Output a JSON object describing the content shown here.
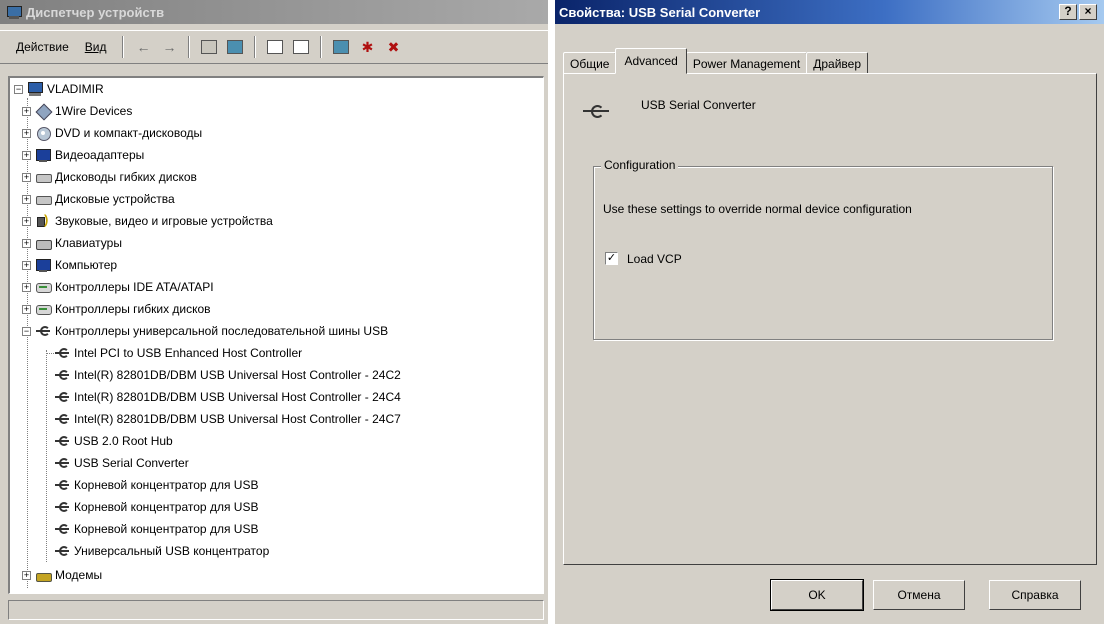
{
  "device_manager": {
    "title": "Диспетчер устройств",
    "menu": {
      "action": "Действие",
      "view": "Вид"
    },
    "toolbar_icons": [
      "back-arrow-icon",
      "forward-arrow-icon",
      "up-folder-icon",
      "properties-list-icon",
      "properties-icon",
      "help-icon",
      "scan-hardware-icon",
      "update-driver-icon",
      "uninstall-icon"
    ],
    "tree": {
      "root": "VLADIMIR",
      "categories": [
        "1Wire Devices",
        "DVD и компакт-дисководы",
        "Видеоадаптеры",
        "Дисководы гибких дисков",
        "Дисковые устройства",
        "Звуковые, видео и игровые устройства",
        "Клавиатуры",
        "Компьютер",
        "Контроллеры IDE ATA/ATAPI",
        "Контроллеры гибких дисков",
        "Контроллеры универсальной последовательной шины USB"
      ],
      "usb_children": [
        "Intel PCI to USB Enhanced Host Controller",
        "Intel(R) 82801DB/DBM USB Universal Host Controller - 24C2",
        "Intel(R) 82801DB/DBM USB Universal Host Controller - 24C4",
        "Intel(R) 82801DB/DBM USB Universal Host Controller - 24C7",
        "USB 2.0 Root Hub",
        "USB Serial Converter",
        "Корневой концентратор для USB",
        "Корневой концентратор для USB",
        "Корневой концентратор для USB",
        "Универсальный USB концентратор"
      ],
      "last": "Модемы"
    }
  },
  "properties": {
    "title": "Свойства: USB Serial Converter",
    "help_btn": "?",
    "close_btn": "×",
    "tabs": [
      "Общие",
      "Advanced",
      "Power Management",
      "Драйвер"
    ],
    "active_tab": "Advanced",
    "device_name": "USB Serial Converter",
    "group_label": "Configuration",
    "description": "Use these settings to override normal device configuration",
    "checkbox_label": "Load VCP",
    "checkbox_checked": true,
    "checkmark": "✓",
    "buttons": {
      "ok": "OK",
      "cancel": "Отмена",
      "help": "Справка"
    }
  }
}
